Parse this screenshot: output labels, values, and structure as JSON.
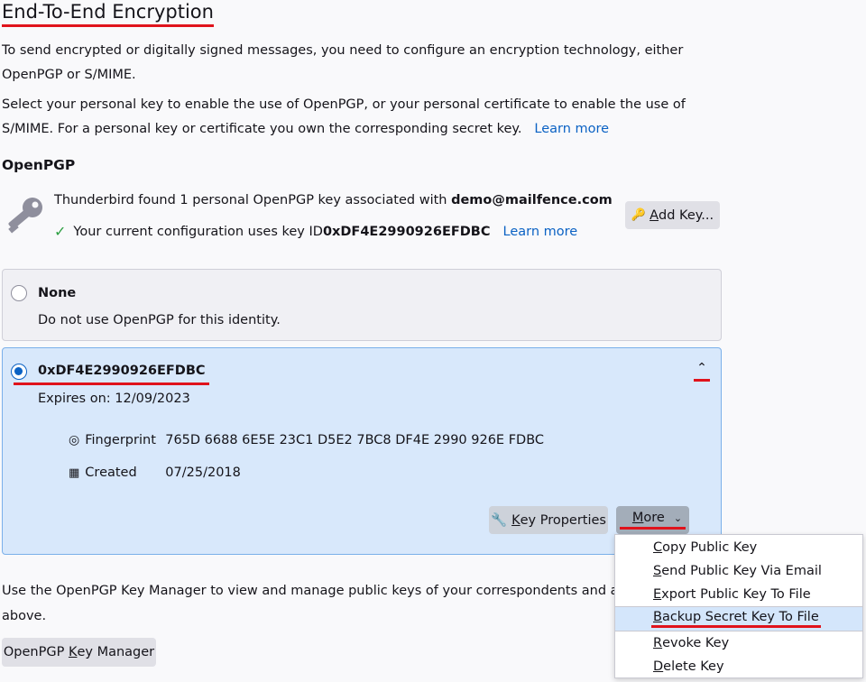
{
  "header": {
    "title": "End-To-End Encryption"
  },
  "intro": {
    "p1": "To send encrypted or digitally signed messages, you need to configure an encryption technology, either OpenPGP or S/MIME.",
    "p2": "Select your personal key to enable the use of OpenPGP, or your personal certificate to enable the use of S/MIME. For a personal key or certificate you own the corresponding secret key.",
    "learn_more": "Learn more"
  },
  "openpgp": {
    "heading": "OpenPGP",
    "found_prefix": "Thunderbird found 1 personal OpenPGP key associated with ",
    "email": "demo@mailfence.com",
    "config_prefix": "Your current configuration uses key ID ",
    "key_id": "0xDF4E2990926EFDBC",
    "learn_more": "Learn more",
    "add_key_first": "A",
    "add_key_rest": "dd Key..."
  },
  "none_option": {
    "label": "None",
    "desc": "Do not use OpenPGP for this identity."
  },
  "key_option": {
    "label": "0xDF4E2990926EFDBC",
    "expires": "Expires on: 12/09/2023",
    "fingerprint_label": "Fingerprint",
    "fingerprint_value": "765D 6688 6E5E 23C1 D5E2 7BC8 DF4E 2990 926E FDBC",
    "created_label": "Created",
    "created_value": "07/25/2018",
    "key_props_first": "K",
    "key_props_rest": "ey Properties",
    "more_first": "M",
    "more_rest": "ore"
  },
  "footer": {
    "text": "Use the OpenPGP Key Manager to view and manage public keys of your correspondents and all other k",
    "text2": "above.",
    "manager_a": "OpenPGP ",
    "manager_k": "K",
    "manager_b": "ey Manager"
  },
  "menu": {
    "items": [
      {
        "first": "C",
        "rest": "opy Public Key"
      },
      {
        "first": "S",
        "rest": "end Public Key Via Email"
      },
      {
        "first": "E",
        "rest": "xport Public Key To File"
      },
      {
        "first": "B",
        "rest": "ackup Secret Key To File"
      },
      {
        "first": "R",
        "rest": "evoke Key"
      },
      {
        "first": "D",
        "rest": "elete Key"
      }
    ]
  },
  "colors": {
    "accent": "#0b62c4",
    "annotation": "#e0131c",
    "selected_card": "#d8e8fb"
  }
}
